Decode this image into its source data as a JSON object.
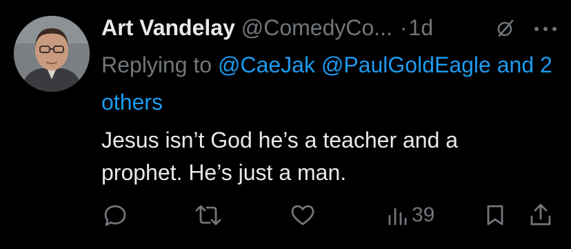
{
  "tweet": {
    "author_name": "Art Vandelay",
    "handle": "@ComedyCo...",
    "separator": "·",
    "time": "1d",
    "replying_prefix": "Replying to",
    "mention_1": "@CaeJak",
    "mention_2": "@PaulGoldEagle",
    "and_others": "and 2 others",
    "text_line_1": "Jesus isn’t God he’s a teacher and a",
    "text_line_2": "prophet. He’s just a man."
  },
  "actions": {
    "views_count": "39"
  },
  "icons": {
    "edited": "edited-icon",
    "more": "more-icon",
    "reply": "reply-icon",
    "retweet": "retweet-icon",
    "like": "heart-icon",
    "views": "views-icon",
    "bookmark": "bookmark-icon",
    "share": "share-icon"
  },
  "colors": {
    "background": "#000000",
    "primary_text": "#e7e9ea",
    "secondary_text": "#71767b",
    "link": "#1d9bf0"
  }
}
